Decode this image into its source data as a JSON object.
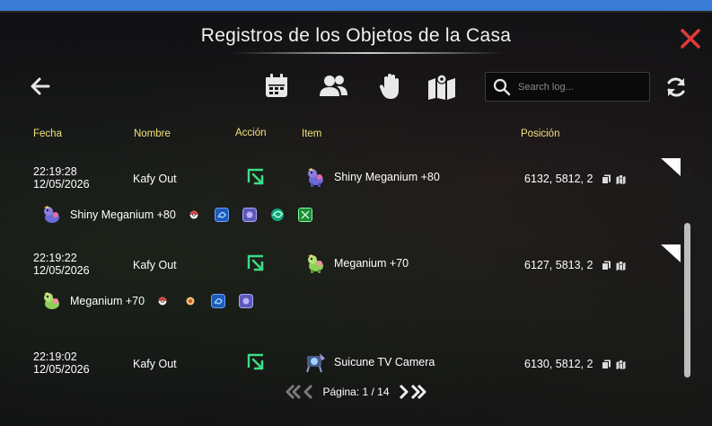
{
  "window": {
    "title": "Registros de los Objetos de la Casa"
  },
  "toolbar": {
    "filters": [
      {
        "name": "calendar-icon"
      },
      {
        "name": "users-icon"
      },
      {
        "name": "hand-icon"
      },
      {
        "name": "map-icon"
      }
    ],
    "search_placeholder": "Search log..."
  },
  "table": {
    "headers": {
      "date": "Fecha",
      "name": "Nombre",
      "action": "Acción",
      "item": "Item",
      "position": "Posición"
    },
    "rows": [
      {
        "time": "22:19:28",
        "date": "12/05/2026",
        "name": "Kafy Out",
        "item": "Shiny Meganium +80",
        "position": "6132, 5812, 2",
        "detail_name": "Shiny Meganium +80",
        "detail_chips": [
          "pokeball",
          "blue-rune",
          "purple-rune",
          "green-swirl",
          "green-box"
        ]
      },
      {
        "time": "22:19:22",
        "date": "12/05/2026",
        "name": "Kafy Out",
        "item": "Meganium +70",
        "position": "6127, 5813, 2",
        "detail_name": "Meganium +70",
        "detail_chips": [
          "pokeball",
          "orange-ball",
          "blue-rune",
          "purple-rune"
        ]
      },
      {
        "time": "22:19:02",
        "date": "12/05/2026",
        "name": "Kafy Out",
        "item": "Suicune TV Camera",
        "position": "6130, 5812, 2"
      }
    ]
  },
  "pagination": {
    "label": "Página: 1 / 14"
  },
  "colors": {
    "header_text": "#f3e27a",
    "close": "#e03a3a",
    "action_green": "#3ddc84",
    "top_bar": "#3a7bd5"
  }
}
